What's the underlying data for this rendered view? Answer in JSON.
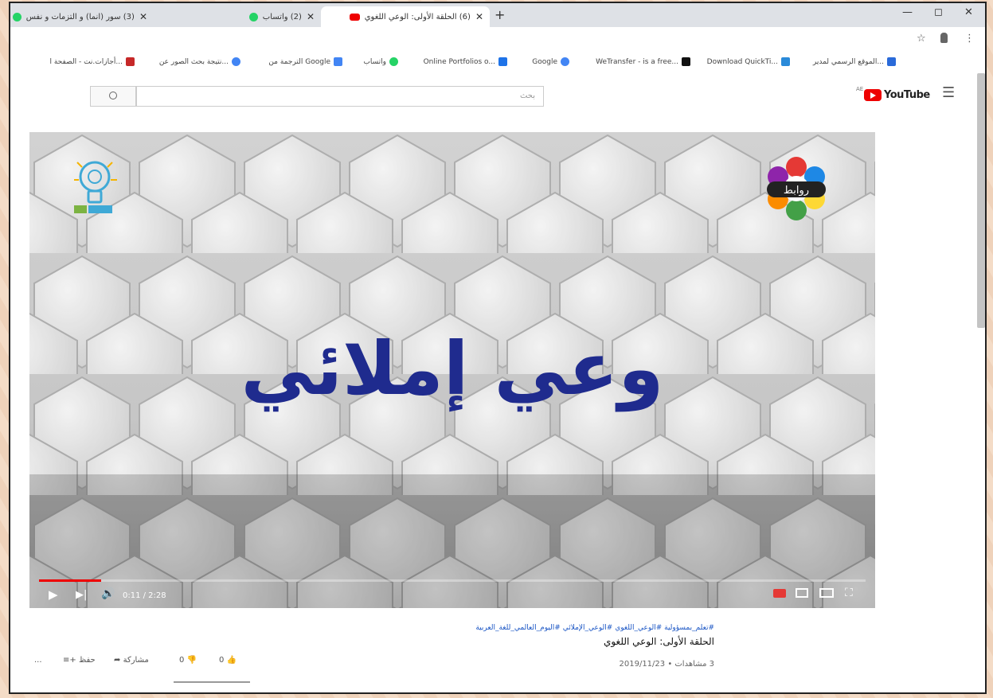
{
  "browser": {
    "tabs": [
      {
        "label": "(3) سور (انما) و التزمات و نفس",
        "close": "✕"
      },
      {
        "label": "(2) واتساب",
        "close": "✕"
      },
      {
        "label": "(6) الحلقة الأولى: الوعي اللغوي",
        "close": "✕"
      }
    ],
    "new_tab": "+",
    "window_controls": {
      "minimize": "—",
      "restore": "◻",
      "close": "✕"
    },
    "star": "☆",
    "menu": "⋮"
  },
  "bookmarks": [
    {
      "label": "الموقع الرسمي لمدير...",
      "color": "#2a6ad9"
    },
    {
      "label": "Download QuickTi...",
      "color": "#2a8ad9"
    },
    {
      "label": "WeTransfer - is a free...",
      "color": "#111111"
    },
    {
      "label": "Google",
      "color": "#4285f4"
    },
    {
      "label": "Online Portfolios o...",
      "color": "#1e73e8"
    },
    {
      "label": "واتساب",
      "color": "#25d366"
    },
    {
      "label": "الترجمة من Google",
      "color": "#4285f4"
    },
    {
      "label": "نتيجة بحث الصور عن...",
      "color": "#4285f4"
    },
    {
      "label": "أجازات.نت - الصفحة ا...",
      "color": "#c62828"
    }
  ],
  "youtube": {
    "logo_text": "YouTube",
    "logo_sup": "AE",
    "search_placeholder": "بحث",
    "search_icon": "🔍"
  },
  "video": {
    "overlay_title": "وعي إملائي",
    "time": "0:11 / 2:28",
    "progress_fraction": 0.075,
    "brand_logo_text": "روابط"
  },
  "info": {
    "hashtags": "#تعلم_بمسؤولية #الوعي_اللغوي #الوعي_الإملائي #اليوم_العالمي_للغة_العربية",
    "title": "الحلقة الأولى: الوعي اللغوي",
    "meta": "3 مشاهدات • 2019/11/23",
    "likes": "0",
    "dislikes": "0",
    "share": "مشاركة",
    "save": "حفظ",
    "more": "..."
  }
}
